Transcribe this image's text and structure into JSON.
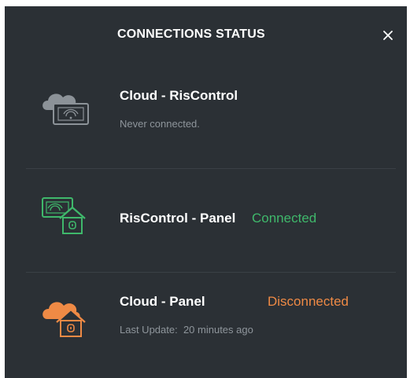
{
  "modal": {
    "title": "CONNECTIONS STATUS",
    "close_label": "×"
  },
  "connections": [
    {
      "name": "Cloud - RisControl",
      "status": "",
      "detail": "Never connected.",
      "icon": "cloud-device-icon",
      "color": "#9aa0a6"
    },
    {
      "name": "RisControl - Panel",
      "status": "Connected",
      "detail": "",
      "icon": "device-house-icon",
      "color": "#3fb86b"
    },
    {
      "name": "Cloud - Panel",
      "status": "Disconnected",
      "detail": "Last Update:  20 minutes ago",
      "icon": "cloud-house-icon",
      "color": "#ef8a45"
    }
  ]
}
